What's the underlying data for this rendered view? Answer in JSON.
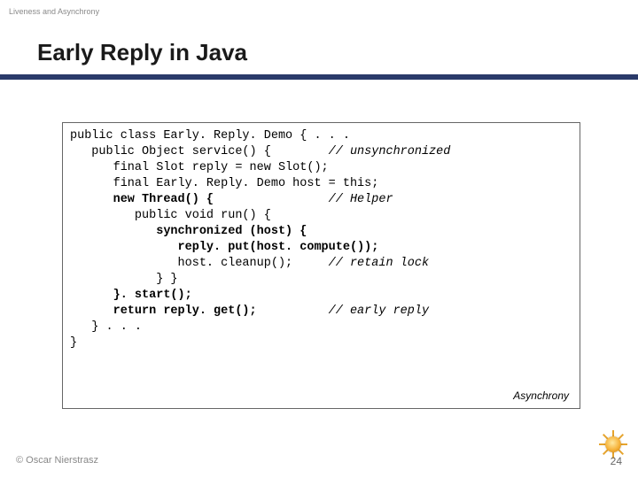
{
  "header": {
    "crumb": "Liveness and Asynchrony",
    "title": "Early Reply in Java"
  },
  "code": {
    "lines": [
      {
        "indent": 0,
        "text": "public class Early. Reply. Demo { . . .",
        "bold": false,
        "comment": ""
      },
      {
        "indent": 1,
        "text": "public Object service() {",
        "bold": false,
        "comment": "// unsynchronized"
      },
      {
        "indent": 2,
        "text": "final Slot reply = new Slot();",
        "bold": false,
        "comment": ""
      },
      {
        "indent": 2,
        "text": "final Early. Reply. Demo host = this;",
        "bold": false,
        "comment": ""
      },
      {
        "indent": 2,
        "text": "new Thread() {",
        "bold": true,
        "comment": "// Helper"
      },
      {
        "indent": 3,
        "text": "public void run() {",
        "bold": false,
        "comment": ""
      },
      {
        "indent": 4,
        "text": "synchronized (host) {",
        "bold": true,
        "comment": ""
      },
      {
        "indent": 5,
        "text": "reply. put(host. compute());",
        "bold": true,
        "comment": ""
      },
      {
        "indent": 5,
        "text": "host. cleanup();",
        "bold": false,
        "comment": "// retain lock"
      },
      {
        "indent": 4,
        "text": "} }",
        "bold": false,
        "comment": ""
      },
      {
        "indent": 2,
        "text": "}. start();",
        "bold": true,
        "comment": ""
      },
      {
        "indent": 2,
        "text": "return reply. get();",
        "bold": true,
        "comment": "// early reply"
      },
      {
        "indent": 1,
        "text": "} . . .",
        "bold": false,
        "comment": ""
      },
      {
        "indent": 0,
        "text": "}",
        "bold": false,
        "comment": ""
      }
    ],
    "comment_col": 36,
    "indent_width": 3
  },
  "tag": "Asynchrony",
  "footer": {
    "copyright": "© Oscar Nierstrasz",
    "page_number": "24"
  }
}
